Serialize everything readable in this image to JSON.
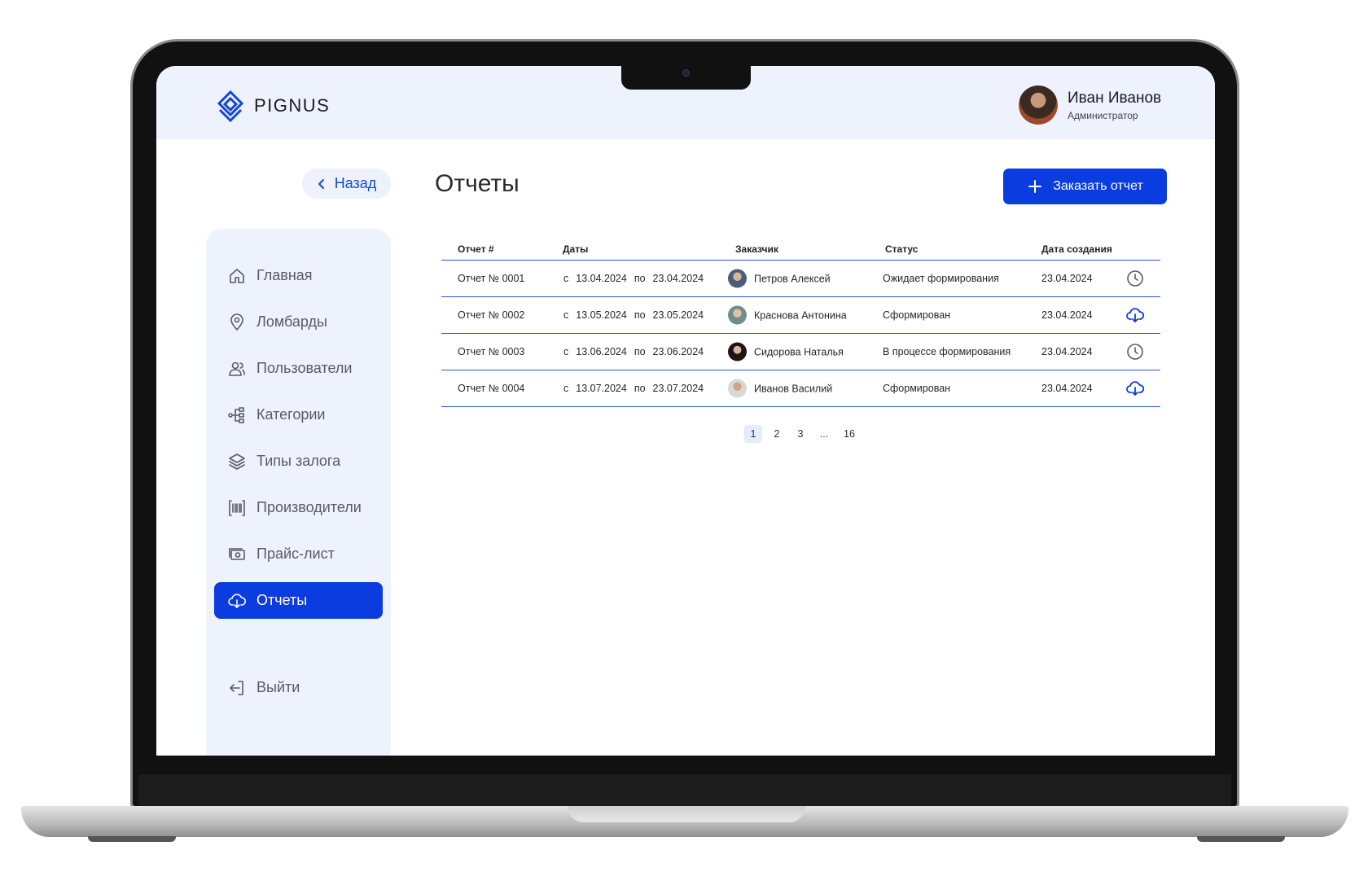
{
  "brand": {
    "name": "PIGNUS"
  },
  "user": {
    "name": "Иван Иванов",
    "role": "Администратор"
  },
  "back_label": "Назад",
  "page_title": "Отчеты",
  "order_button_label": "Заказать отчет",
  "sidebar": {
    "items": [
      {
        "label": "Главная",
        "icon": "home-icon",
        "active": false
      },
      {
        "label": "Ломбарды",
        "icon": "map-pin-icon",
        "active": false
      },
      {
        "label": "Пользователи",
        "icon": "users-icon",
        "active": false
      },
      {
        "label": "Категории",
        "icon": "tree-icon",
        "active": false
      },
      {
        "label": "Типы залога",
        "icon": "layers-icon",
        "active": false
      },
      {
        "label": "Производители",
        "icon": "barcode-icon",
        "active": false
      },
      {
        "label": "Прайс-лист",
        "icon": "money-icon",
        "active": false
      },
      {
        "label": "Отчеты",
        "icon": "cloud-download-icon",
        "active": true
      }
    ],
    "logout": {
      "label": "Выйти",
      "icon": "logout-icon"
    }
  },
  "table": {
    "columns": [
      "Отчет #",
      "Даты",
      "Заказчик",
      "Статус",
      "Дата создания"
    ],
    "date_from_prefix": "с",
    "date_to_prefix": "по",
    "rows": [
      {
        "report": "Отчет № 0001",
        "from": "13.04.2024",
        "to": "23.04.2024",
        "customer": "Петров Алексей",
        "status": "Ожидает формирования",
        "created": "23.04.2024",
        "action_icon": "clock-icon"
      },
      {
        "report": "Отчет № 0002",
        "from": "13.05.2024",
        "to": "23.05.2024",
        "customer": "Краснова Антонина",
        "status": "Сформирован",
        "created": "23.04.2024",
        "action_icon": "cloud-download-icon"
      },
      {
        "report": "Отчет № 0003",
        "from": "13.06.2024",
        "to": "23.06.2024",
        "customer": "Сидорова Наталья",
        "status": "В процессе формирования",
        "created": "23.04.2024",
        "action_icon": "clock-icon"
      },
      {
        "report": "Отчет № 0004",
        "from": "13.07.2024",
        "to": "23.07.2024",
        "customer": "Иванов Василий",
        "status": "Сформирован",
        "created": "23.04.2024",
        "action_icon": "cloud-download-icon"
      }
    ]
  },
  "pagination": {
    "pages": [
      "1",
      "2",
      "3",
      "...",
      "16"
    ],
    "current": "1"
  },
  "colors": {
    "accent": "#0a3ce0",
    "panel": "#edf2fd",
    "pending_icon": "#5a5a63"
  }
}
